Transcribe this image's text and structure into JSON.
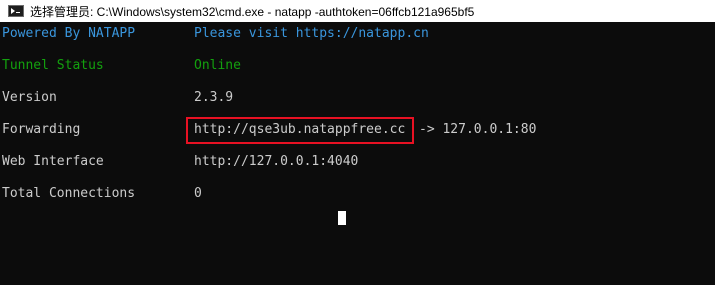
{
  "window": {
    "title": "选择管理员: C:\\Windows\\system32\\cmd.exe - natapp  -authtoken=06ffcb121a965bf5"
  },
  "console": {
    "header": {
      "label": "Powered By NATAPP",
      "value": "Please visit https://natapp.cn"
    },
    "tunnel_status": {
      "label": "Tunnel Status",
      "value": "Online"
    },
    "version": {
      "label": "Version",
      "value": "2.3.9"
    },
    "forwarding": {
      "label": "Forwarding",
      "url": "http://qse3ub.natappfree.cc",
      "target": "-> 127.0.0.1:80"
    },
    "web_interface": {
      "label": "Web Interface",
      "value": "http://127.0.0.1:4040"
    },
    "total_connections": {
      "label": "Total Connections",
      "value": "0"
    }
  },
  "colors": {
    "background": "#0c0c0c",
    "header_text": "#3a96dd",
    "status_text": "#13a10e",
    "default_text": "#cccccc",
    "highlight_box": "#e81123"
  },
  "icons": {
    "title_icon": "cmd-icon"
  }
}
